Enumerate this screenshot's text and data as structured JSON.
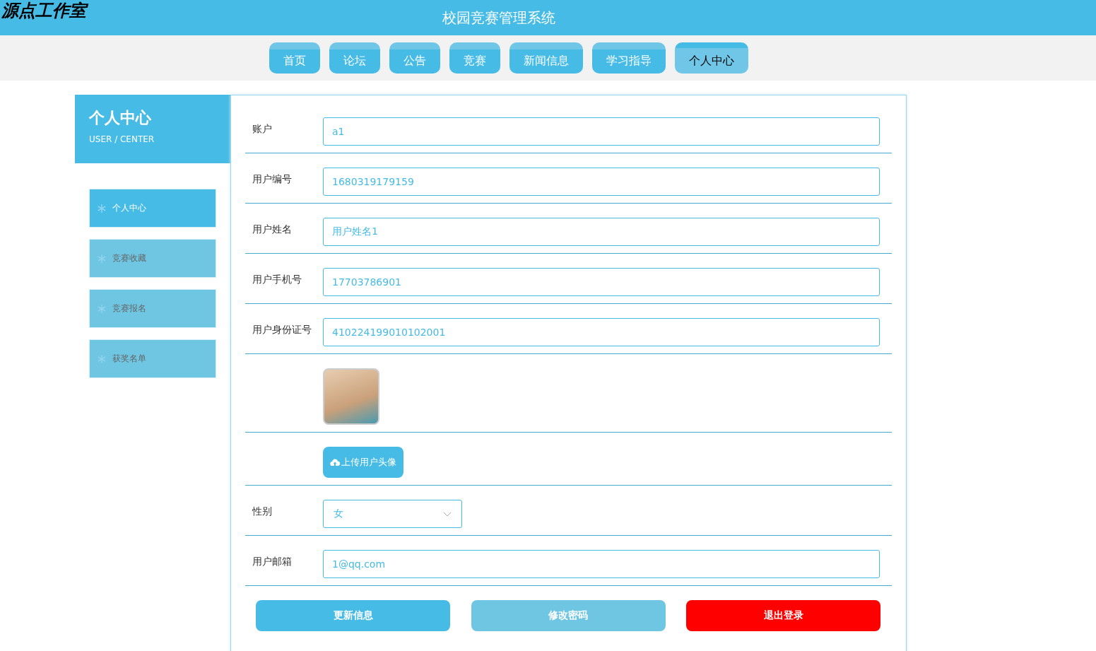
{
  "header": {
    "logo": "源点工作室",
    "title": "校园竞赛管理系统"
  },
  "nav_tabs": [
    {
      "label": "首页",
      "selected": false
    },
    {
      "label": "论坛",
      "selected": false
    },
    {
      "label": "公告",
      "selected": false
    },
    {
      "label": "竞赛",
      "selected": false
    },
    {
      "label": "新闻信息",
      "selected": false
    },
    {
      "label": "学习指导",
      "selected": false
    },
    {
      "label": "个人中心",
      "selected": true
    }
  ],
  "sidebar": {
    "title": "个人中心",
    "subtitle": "USER / CENTER",
    "items": [
      {
        "label": "个人中心",
        "selected": true
      },
      {
        "label": "竞赛收藏",
        "selected": false
      },
      {
        "label": "竞赛报名",
        "selected": false
      },
      {
        "label": "获奖名单",
        "selected": false
      }
    ]
  },
  "form": {
    "fields": [
      {
        "kind": "input",
        "label": "账户",
        "value": "a1"
      },
      {
        "kind": "input",
        "label": "用户编号",
        "value": "1680319179159"
      },
      {
        "kind": "input",
        "label": "用户姓名",
        "value": "用户姓名1"
      },
      {
        "kind": "input",
        "label": "用户手机号",
        "value": "17703786901"
      },
      {
        "kind": "input",
        "label": "用户身份证号",
        "value": "410224199010102001"
      },
      {
        "kind": "image"
      },
      {
        "kind": "upload",
        "button": "上传用户头像"
      },
      {
        "kind": "select",
        "label": "性别",
        "value": "女"
      },
      {
        "kind": "input",
        "label": "用户邮箱",
        "value": "1@qq.com"
      }
    ],
    "buttons": [
      {
        "kind": "primary",
        "label": "更新信息"
      },
      {
        "kind": "secondary",
        "label": "修改密码"
      },
      {
        "kind": "danger",
        "label": "退出登录"
      }
    ]
  }
}
